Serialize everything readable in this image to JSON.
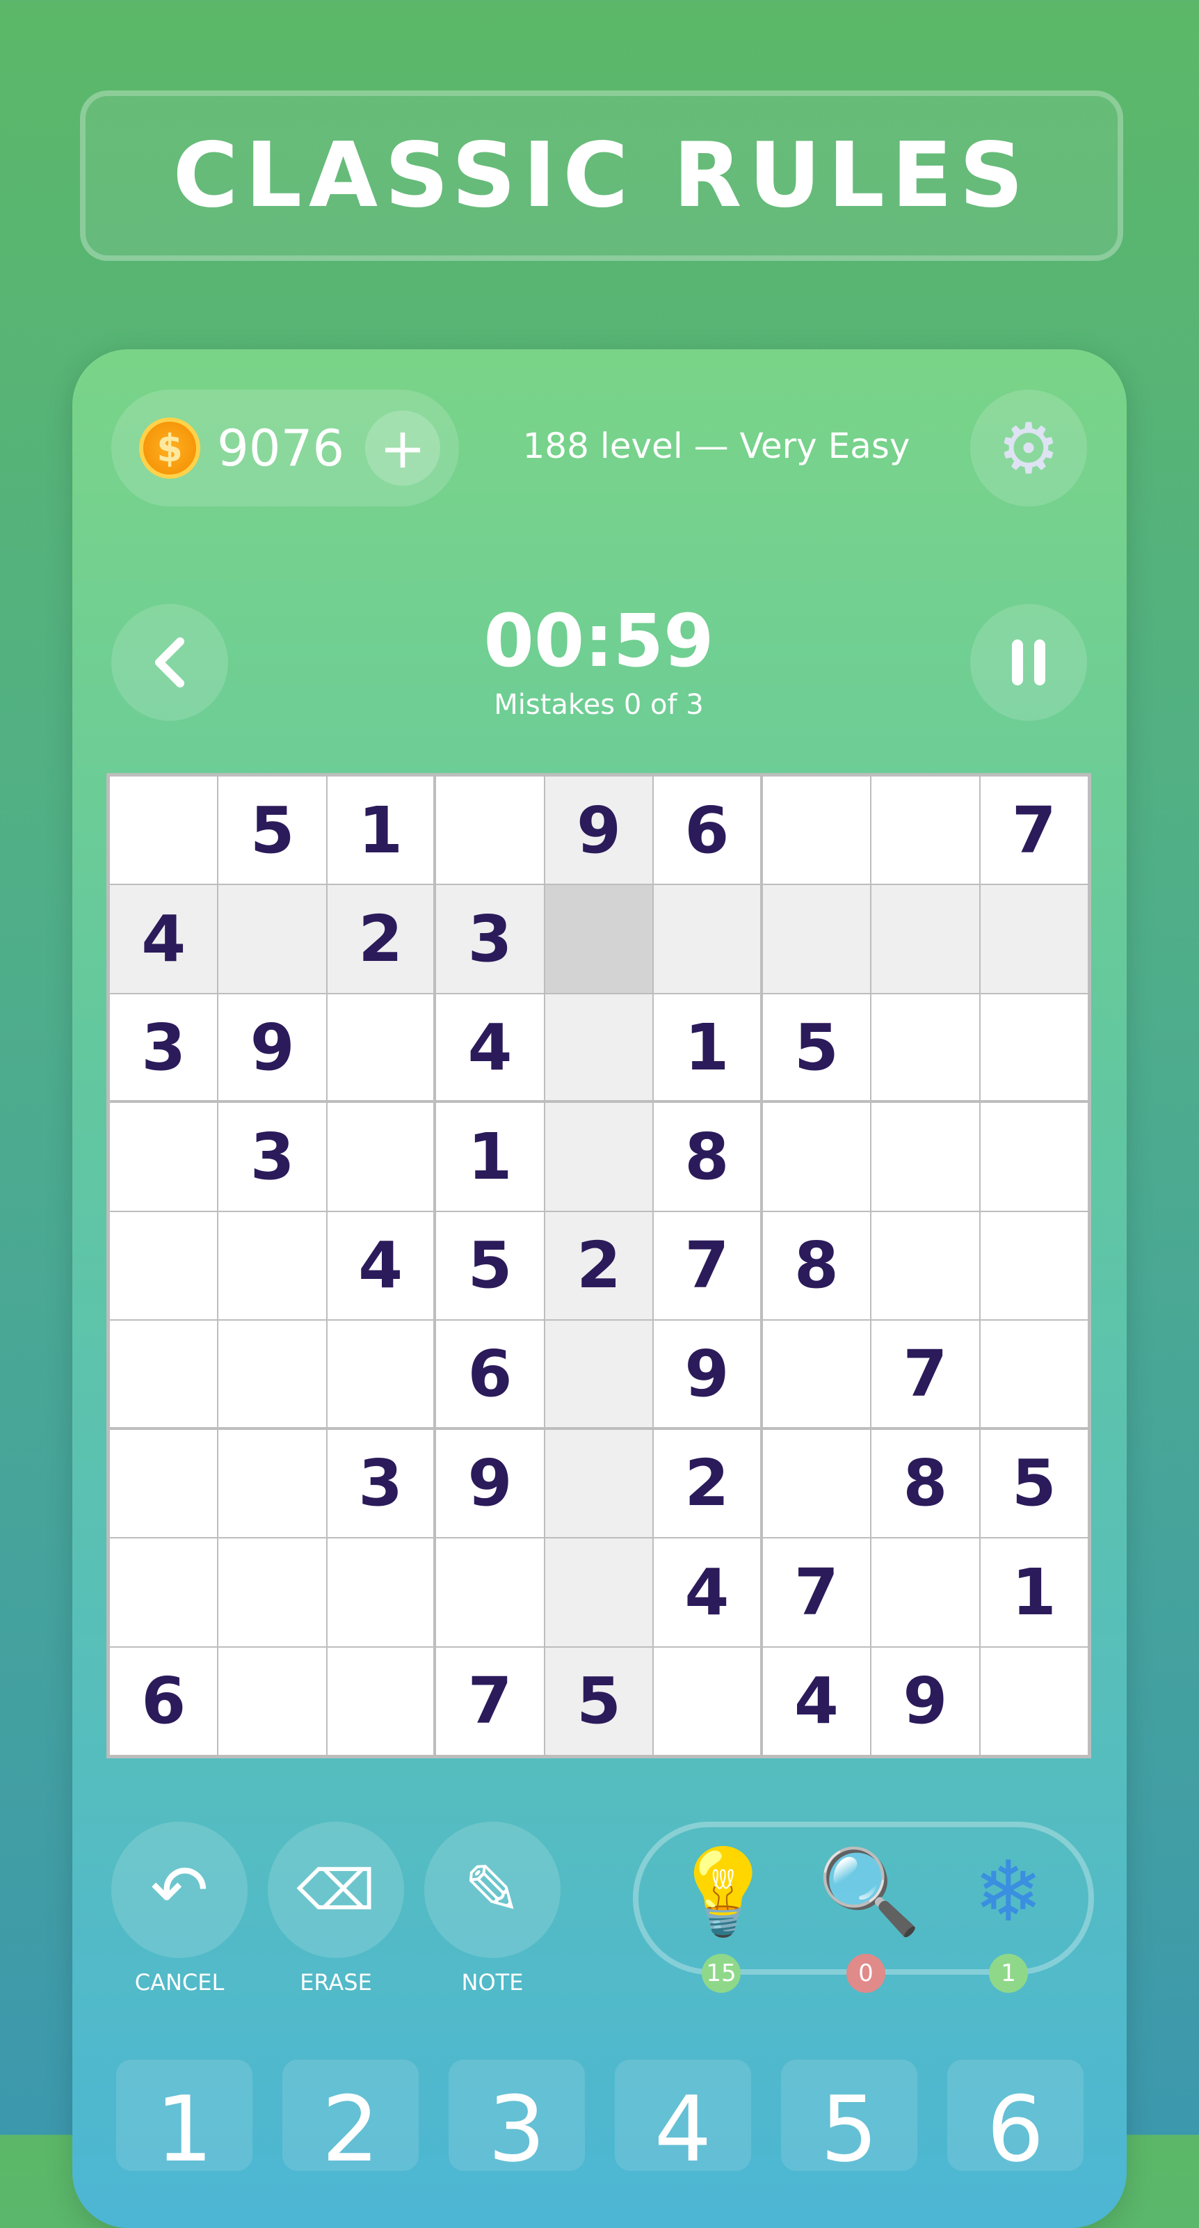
{
  "banner": {
    "title": "CLASSIC RULES"
  },
  "header": {
    "coins": "9076",
    "coin_symbol": "$",
    "add_label": "+",
    "level": "188 level — Very Easy",
    "settings_icon": "gear-icon"
  },
  "timer": {
    "time": "00:59",
    "mistakes": "Mistakes 0 of 3",
    "back_icon": "chevron-left-icon",
    "pause_icon": "pause-icon"
  },
  "board": {
    "rows": [
      [
        "",
        "5",
        "1",
        "",
        "9",
        "6",
        "",
        "",
        "7"
      ],
      [
        "4",
        "",
        "2",
        "3",
        "",
        "",
        "",
        "",
        ""
      ],
      [
        "3",
        "9",
        "",
        "4",
        "",
        "1",
        "5",
        "",
        ""
      ],
      [
        "",
        "3",
        "",
        "1",
        "",
        "8",
        "",
        "",
        ""
      ],
      [
        "",
        "",
        "4",
        "5",
        "2",
        "7",
        "8",
        "",
        ""
      ],
      [
        "",
        "",
        "",
        "6",
        "",
        "9",
        "",
        "7",
        ""
      ],
      [
        "",
        "",
        "3",
        "9",
        "",
        "2",
        "",
        "8",
        "5"
      ],
      [
        "",
        "",
        "",
        "",
        "",
        "4",
        "7",
        "",
        "1"
      ],
      [
        "6",
        "",
        "",
        "7",
        "5",
        "",
        "4",
        "9",
        ""
      ]
    ],
    "selected": {
      "row": 2,
      "col": 5
    }
  },
  "tools": [
    {
      "label": "CANCEL",
      "icon": "undo-icon"
    },
    {
      "label": "ERASE",
      "icon": "eraser-icon"
    },
    {
      "label": "NOTE",
      "icon": "pencil-icon"
    }
  ],
  "hints": [
    {
      "icon": "lightbulb-icon",
      "count": "15",
      "color": "#8fd88a"
    },
    {
      "icon": "magnifier-icon",
      "count": "0",
      "color": "#e08a8a"
    },
    {
      "icon": "snowflake-icon",
      "count": "1",
      "color": "#8fd88a"
    }
  ],
  "numpad": [
    "1",
    "2",
    "3",
    "4",
    "5",
    "6"
  ],
  "colors": {
    "digit": "#2b1b5a",
    "highlight": "#efefef",
    "selected": "#d3d3d3"
  }
}
